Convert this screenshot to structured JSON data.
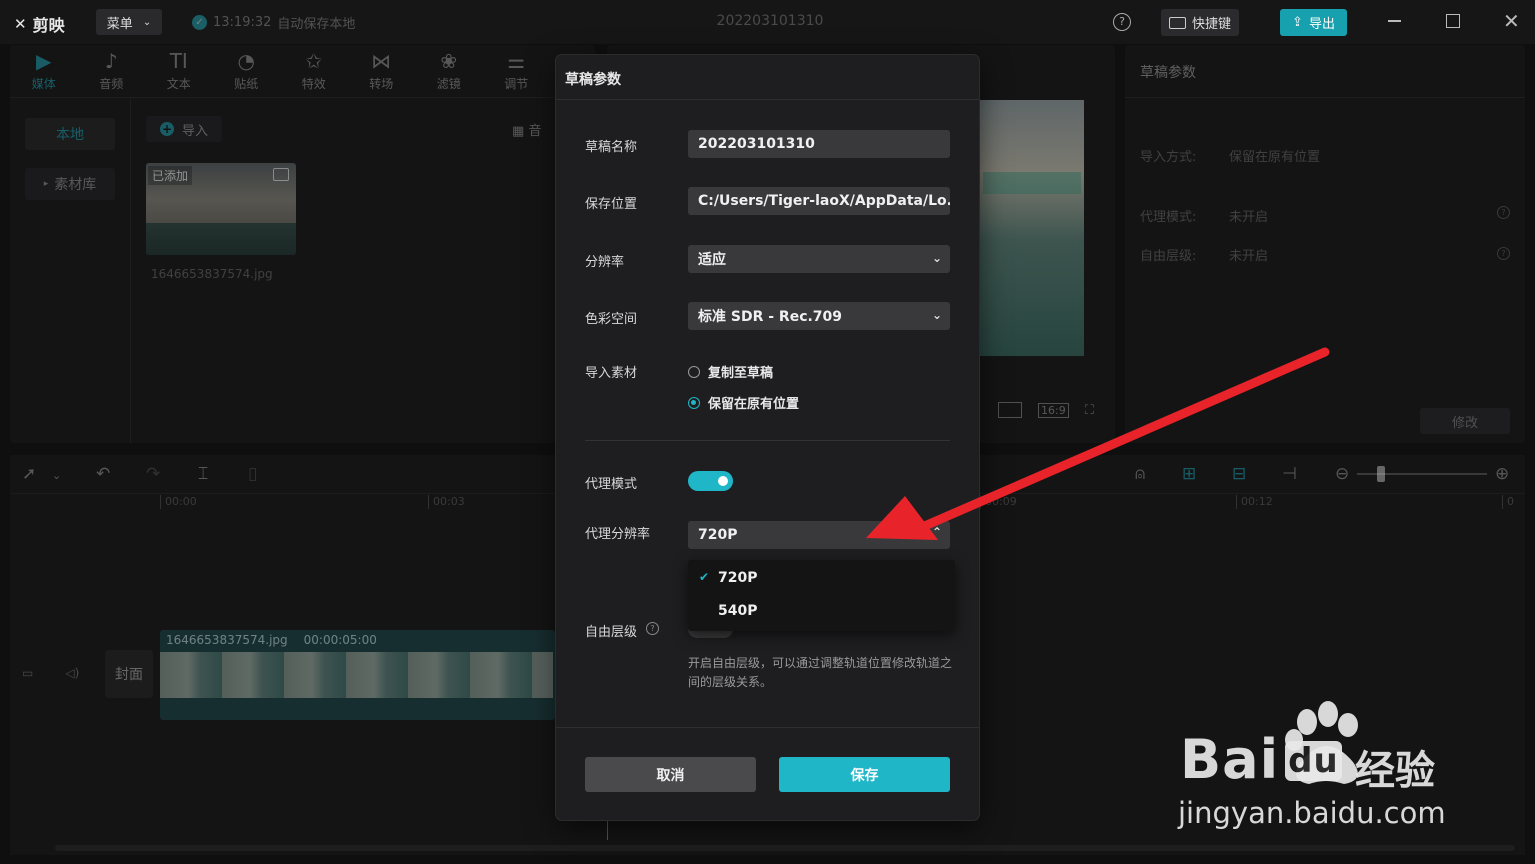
{
  "app": {
    "logo_text": "剪映",
    "menu_label": "菜单",
    "autosave_time": "13:19:32",
    "autosave_text": "自动保存本地",
    "window_title": "202203101310",
    "help_glyph": "?",
    "shortcut_label": "快捷键",
    "export_label": "导出"
  },
  "tool_tabs": [
    {
      "label": "媒体",
      "icon": "media-icon",
      "glyph": "▶"
    },
    {
      "label": "音频",
      "icon": "audio-icon",
      "glyph": "♪"
    },
    {
      "label": "文本",
      "icon": "text-icon",
      "glyph": "TI"
    },
    {
      "label": "贴纸",
      "icon": "sticker-icon",
      "glyph": "◔"
    },
    {
      "label": "特效",
      "icon": "effects-icon",
      "glyph": "✩"
    },
    {
      "label": "转场",
      "icon": "transition-icon",
      "glyph": "⋈"
    },
    {
      "label": "滤镜",
      "icon": "filter-icon",
      "glyph": "❀"
    },
    {
      "label": "调节",
      "icon": "adjust-icon",
      "glyph": "⚌"
    }
  ],
  "media": {
    "side_local": "本地",
    "side_library": "素材库",
    "import_label": "导入",
    "view_label": "音",
    "thumb_badge": "已添加",
    "thumb_name": "1646653837574.jpg"
  },
  "player": {
    "ratio": "16:9"
  },
  "props": {
    "title": "草稿参数",
    "rows": [
      {
        "k": "导入方式:",
        "v": "保留在原有位置"
      },
      {
        "k": "代理模式:",
        "v": "未开启"
      },
      {
        "k": "自由层级:",
        "v": "未开启"
      }
    ],
    "modify_label": "修改"
  },
  "timeline": {
    "ticks": [
      "00:00",
      "00:03",
      "00:09",
      "00:12",
      "0"
    ],
    "clip_name": "1646653837574.jpg",
    "clip_duration": "00:00:05:00",
    "cover_label": "封面"
  },
  "dialog": {
    "title": "草稿参数",
    "name_label": "草稿名称",
    "name_value": "202203101310",
    "path_label": "保存位置",
    "path_value": "C:/Users/Tiger-laoX/AppData/Lo...",
    "res_label": "分辨率",
    "res_value": "适应",
    "color_label": "色彩空间",
    "color_value": "标准 SDR - Rec.709",
    "import_label": "导入素材",
    "import_opt1": "复制至草稿",
    "import_opt2": "保留在原有位置",
    "import_selected": 2,
    "proxy_label": "代理模式",
    "proxy_on": true,
    "proxy_res_label": "代理分辨率",
    "proxy_res_value": "720P",
    "proxy_options": [
      "720P",
      "540P"
    ],
    "free_label": "自由层级",
    "free_on": false,
    "free_desc": "开启自由层级，可以通过调整轨道位置修改轨道之间的层级关系。",
    "cancel_label": "取消",
    "save_label": "保存"
  },
  "annotation": {
    "arrow_color": "#e8242a"
  },
  "watermark": {
    "brand": "Bai",
    "brand_du": "du",
    "cn": "经验",
    "url": "jingyan.baidu.com"
  },
  "colors": {
    "accent": "#1fb6c7",
    "background": "#0f0f10",
    "panel": "#1b1b1c"
  }
}
